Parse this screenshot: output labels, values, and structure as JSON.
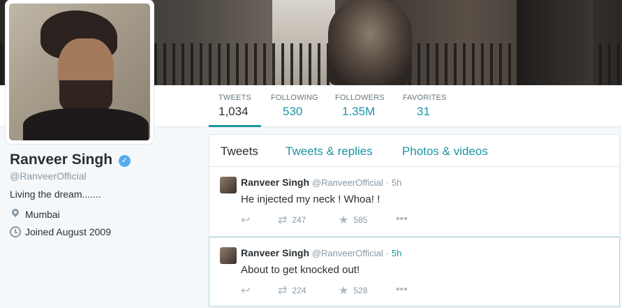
{
  "profile": {
    "name": "Ranveer Singh",
    "handle": "@RanveerOfficial",
    "bio": "Living the dream.......",
    "location": "Mumbai",
    "joined": "Joined August 2009"
  },
  "stats": [
    {
      "label": "TWEETS",
      "value": "1,034"
    },
    {
      "label": "FOLLOWING",
      "value": "530"
    },
    {
      "label": "FOLLOWERS",
      "value": "1.35M"
    },
    {
      "label": "FAVORITES",
      "value": "31"
    }
  ],
  "tabs": [
    {
      "label": "Tweets"
    },
    {
      "label": "Tweets & replies"
    },
    {
      "label": "Photos & videos"
    }
  ],
  "tweets": [
    {
      "name": "Ranveer Singh",
      "handle": "@RanveerOfficial",
      "separator": "·",
      "time": "5h",
      "text": "He injected my neck ! Whoa! !",
      "retweets": "247",
      "favorites": "585"
    },
    {
      "name": "Ranveer Singh",
      "handle": "@RanveerOfficial",
      "separator": "·",
      "time": "5h",
      "text": "About to get knocked out!",
      "retweets": "224",
      "favorites": "528"
    }
  ],
  "icons": {
    "reply": "reply-icon",
    "retweet": "retweet-icon",
    "favorite": "star-icon",
    "more": "more-icon",
    "verified": "verified-badge-icon",
    "location": "location-pin-icon",
    "joined": "calendar-clock-icon"
  },
  "colors": {
    "accent": "#1b95a3",
    "verified": "#55acee",
    "muted": "#8899a6"
  }
}
